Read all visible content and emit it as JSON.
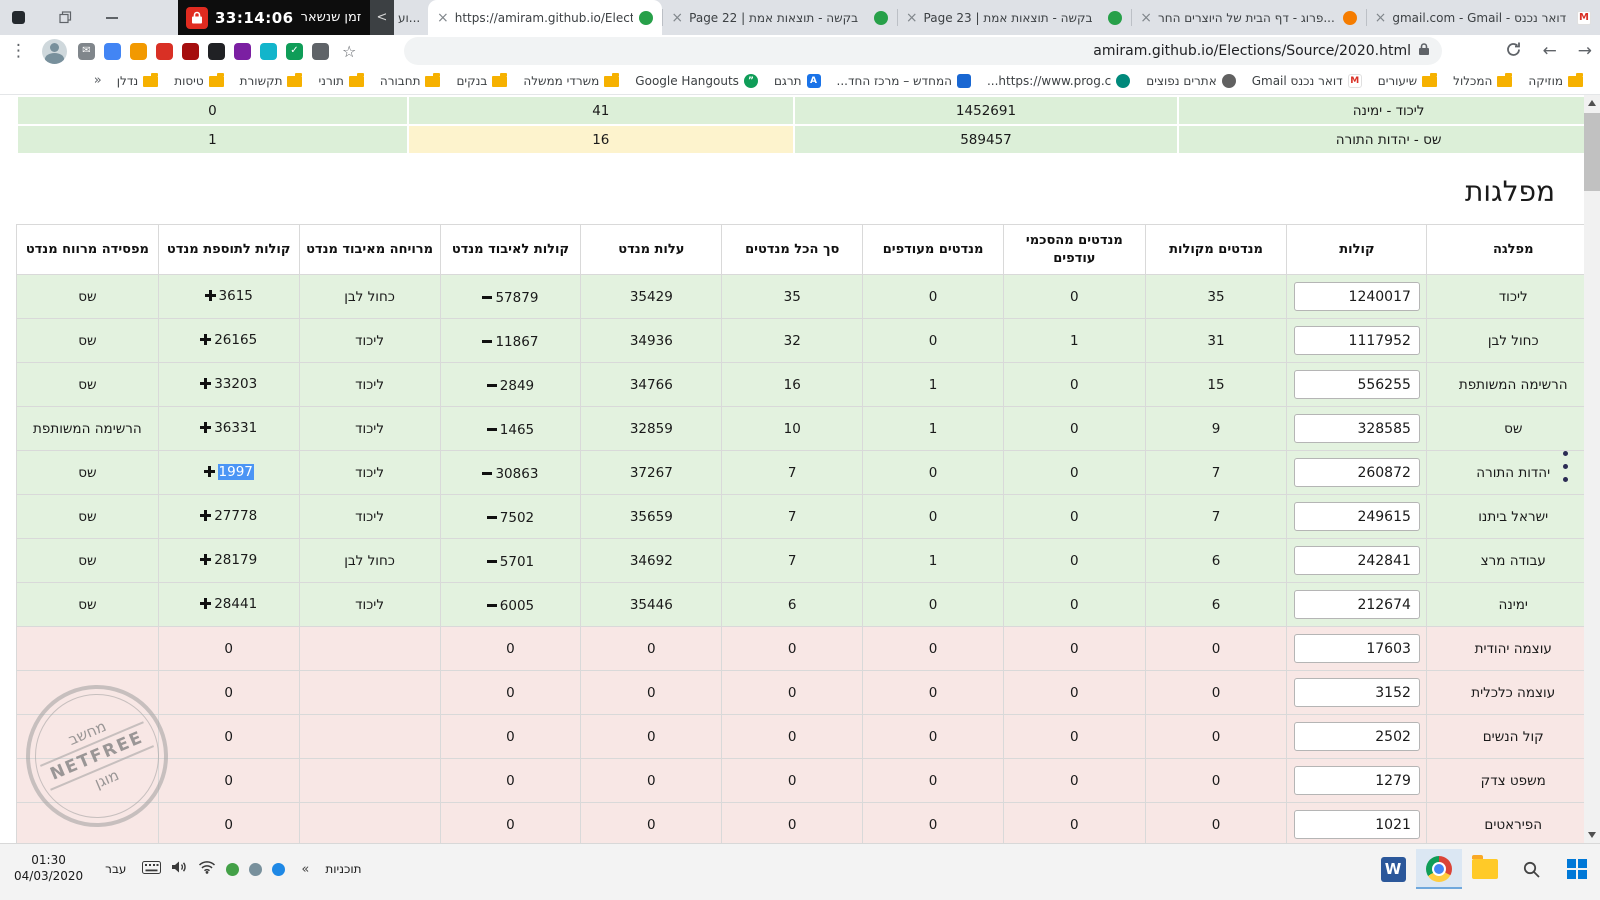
{
  "browser": {
    "netfree_timer": {
      "time": "33:14:06",
      "label": "זמן שנשאר",
      "collapse": "<"
    },
    "tabs": [
      {
        "title": "וע...",
        "type": "partial"
      },
      {
        "title": "https://amiram.github.io/Elect",
        "icon": "epic-icon",
        "active": true
      },
      {
        "title": "Page 22 | בקשה - תוצאות אמת",
        "icon": "epic-icon"
      },
      {
        "title": "Page 23 | בקשה - תוצאות אמת",
        "icon": "epic-icon"
      },
      {
        "title": "פרוג - דף הבית של היוצרים החר...",
        "icon": "prog-icon"
      },
      {
        "title": "gmail.com - Gmail - דואר נכנס",
        "icon": "gmail-icon"
      }
    ],
    "toolbar": {
      "url": "amiram.github.io/Elections/Source/2020.html",
      "extensions": [
        {
          "name": "mail-extension-icon",
          "color": "#80868b",
          "glyph": "✉"
        },
        {
          "name": "blue-extension-icon",
          "color": "#4285f4",
          "glyph": ""
        },
        {
          "name": "orange-extension-icon",
          "color": "#f29900",
          "glyph": ""
        },
        {
          "name": "red-extension-icon",
          "color": "#d93025",
          "glyph": ""
        },
        {
          "name": "darkred-extension-icon",
          "color": "#a50e0e",
          "glyph": ""
        },
        {
          "name": "black-extension-icon",
          "color": "#202124",
          "glyph": ""
        },
        {
          "name": "purple-extension-icon",
          "color": "#7b1fa2",
          "glyph": ""
        },
        {
          "name": "teal-extension-icon",
          "color": "#12b5cb",
          "glyph": ""
        },
        {
          "name": "green-check-extension-icon",
          "color": "#0f9d58",
          "glyph": "✓"
        },
        {
          "name": "gray-extension-icon",
          "color": "#5f6368",
          "glyph": ""
        }
      ]
    },
    "bookmarks": [
      {
        "label": "מוזיקה",
        "icon": "folder"
      },
      {
        "label": "המכלול",
        "icon": "folder"
      },
      {
        "label": "שיעורים",
        "icon": "folder"
      },
      {
        "label": "דואר נכנס Gmail",
        "icon": "gmail"
      },
      {
        "label": "אתרים נפוצים",
        "icon": "globe"
      },
      {
        "label": "https://www.prog.c...",
        "icon": "site-teal"
      },
      {
        "label": "המחדש – מרכז החד...",
        "icon": "site-blue"
      },
      {
        "label": "תרגם",
        "icon": "translate"
      },
      {
        "label": "Google Hangouts",
        "icon": "hangouts"
      },
      {
        "label": "משרדי ממשלה",
        "icon": "folder"
      },
      {
        "label": "בנקים",
        "icon": "folder"
      },
      {
        "label": "תחבורה",
        "icon": "folder"
      },
      {
        "label": "תורני",
        "icon": "folder"
      },
      {
        "label": "תקשורת",
        "icon": "folder"
      },
      {
        "label": "טיסות",
        "icon": "folder"
      },
      {
        "label": "נדלן",
        "icon": "folder"
      },
      {
        "label": "«",
        "icon": "chevrons"
      }
    ]
  },
  "page": {
    "heading": "מפלגות",
    "summary_rows": [
      {
        "party": "ליכוד - ימינה",
        "votes": "1452691",
        "seats": "41",
        "extra": "0",
        "highlight_seats": false
      },
      {
        "party": "שס - יהדות התורה",
        "votes": "589457",
        "seats": "16",
        "extra": "1",
        "highlight_seats": true
      }
    ],
    "table": {
      "headers": [
        "מפלגה",
        "קולות",
        "מנדטים מקולות",
        "מנדטים מהסכמי עודפים",
        "מנדטים מעודפים",
        "סך הכל מנדטים",
        "עלות מנדט",
        "קולות לאיבוד מנדט",
        "מרויחה מאיבוד מנדט",
        "קולות לתוספת מנדט",
        "מפסידה מרווח מנדט"
      ],
      "rows": [
        {
          "party": "ליכוד",
          "votes": "1240017",
          "m_votes": "35",
          "m_agree": "0",
          "m_surplus": "0",
          "m_total": "35",
          "total_hl": true,
          "cost": "35429",
          "lose": "57879",
          "lose_sign": "minus",
          "gain_party": "כחול לבן",
          "add": "3615",
          "add_sign": "plus",
          "add_sel": false,
          "lose_party": "שס",
          "status": "green"
        },
        {
          "party": "כחול לבן",
          "votes": "1117952",
          "m_votes": "31",
          "m_agree": "1",
          "m_surplus": "0",
          "m_total": "32",
          "total_hl": false,
          "cost": "34936",
          "lose": "11867",
          "lose_sign": "minus",
          "gain_party": "ליכוד",
          "add": "26165",
          "add_sign": "plus",
          "add_sel": false,
          "lose_party": "שס",
          "status": "green"
        },
        {
          "party": "הרשימה המשותפת",
          "votes": "556255",
          "m_votes": "15",
          "m_agree": "0",
          "m_surplus": "1",
          "m_total": "16",
          "total_hl": false,
          "cost": "34766",
          "lose": "2849",
          "lose_sign": "minus",
          "gain_party": "ליכוד",
          "add": "33203",
          "add_sign": "plus",
          "add_sel": false,
          "lose_party": "שס",
          "status": "green"
        },
        {
          "party": "שס",
          "votes": "328585",
          "m_votes": "9",
          "m_agree": "0",
          "m_surplus": "1",
          "m_total": "10",
          "total_hl": false,
          "cost": "32859",
          "lose": "1465",
          "lose_sign": "minus",
          "gain_party": "ליכוד",
          "add": "36331",
          "add_sign": "plus",
          "add_sel": false,
          "lose_party": "הרשימה המשותפת",
          "status": "green"
        },
        {
          "party": "יהדות התורה",
          "votes": "260872",
          "m_votes": "7",
          "m_agree": "0",
          "m_surplus": "0",
          "m_total": "7",
          "total_hl": false,
          "cost": "37267",
          "lose": "30863",
          "lose_sign": "minus",
          "gain_party": "ליכוד",
          "add": "1997",
          "add_sign": "plus",
          "add_sel": true,
          "lose_party": "שס",
          "status": "green"
        },
        {
          "party": "ישראל ביתנו",
          "votes": "249615",
          "m_votes": "7",
          "m_agree": "0",
          "m_surplus": "0",
          "m_total": "7",
          "total_hl": false,
          "cost": "35659",
          "lose": "7502",
          "lose_sign": "minus",
          "gain_party": "ליכוד",
          "add": "27778",
          "add_sign": "plus",
          "add_sel": false,
          "lose_party": "שס",
          "status": "green"
        },
        {
          "party": "עבודה מרצ",
          "votes": "242841",
          "m_votes": "6",
          "m_agree": "0",
          "m_surplus": "1",
          "m_total": "7",
          "total_hl": false,
          "cost": "34692",
          "lose": "5701",
          "lose_sign": "minus",
          "gain_party": "כחול לבן",
          "add": "28179",
          "add_sign": "plus",
          "add_sel": false,
          "lose_party": "שס",
          "status": "green"
        },
        {
          "party": "ימינה",
          "votes": "212674",
          "m_votes": "6",
          "m_agree": "0",
          "m_surplus": "0",
          "m_total": "6",
          "total_hl": false,
          "cost": "35446",
          "lose": "6005",
          "lose_sign": "minus",
          "gain_party": "ליכוד",
          "add": "28441",
          "add_sign": "plus",
          "add_sel": false,
          "lose_party": "שס",
          "status": "green"
        },
        {
          "party": "עוצמה יהודית",
          "votes": "17603",
          "m_votes": "0",
          "m_agree": "0",
          "m_surplus": "0",
          "m_total": "0",
          "total_hl": false,
          "cost": "0",
          "lose": "0",
          "lose_sign": "none",
          "gain_party": "",
          "add": "0",
          "add_sign": "none",
          "add_sel": false,
          "lose_party": "",
          "status": "red"
        },
        {
          "party": "עוצמה כלכלית",
          "votes": "3152",
          "m_votes": "0",
          "m_agree": "0",
          "m_surplus": "0",
          "m_total": "0",
          "total_hl": false,
          "cost": "0",
          "lose": "0",
          "lose_sign": "none",
          "gain_party": "",
          "add": "0",
          "add_sign": "none",
          "add_sel": false,
          "lose_party": "",
          "status": "red"
        },
        {
          "party": "קול הנשים",
          "votes": "2502",
          "m_votes": "0",
          "m_agree": "0",
          "m_surplus": "0",
          "m_total": "0",
          "total_hl": false,
          "cost": "0",
          "lose": "0",
          "lose_sign": "none",
          "gain_party": "",
          "add": "0",
          "add_sign": "none",
          "add_sel": false,
          "lose_party": "",
          "status": "red"
        },
        {
          "party": "משפט צדק",
          "votes": "1279",
          "m_votes": "0",
          "m_agree": "0",
          "m_surplus": "0",
          "m_total": "0",
          "total_hl": false,
          "cost": "0",
          "lose": "0",
          "lose_sign": "none",
          "gain_party": "",
          "add": "0",
          "add_sign": "none",
          "add_sel": false,
          "lose_party": "",
          "status": "red"
        },
        {
          "party": "הפיראטים",
          "votes": "1021",
          "m_votes": "0",
          "m_agree": "0",
          "m_surplus": "0",
          "m_total": "0",
          "total_hl": false,
          "cost": "0",
          "lose": "0",
          "lose_sign": "none",
          "gain_party": "",
          "add": "0",
          "add_sign": "none",
          "add_sel": false,
          "lose_party": "",
          "status": "red"
        }
      ]
    },
    "stamp": {
      "top": "מחשב",
      "middle": "NETFREE",
      "bottom": "מוגן"
    }
  },
  "taskbar": {
    "clock_time": "01:30",
    "clock_date": "04/03/2020",
    "language": "עבר",
    "chevron": "«",
    "toolbar_label": "תוכניות"
  }
}
